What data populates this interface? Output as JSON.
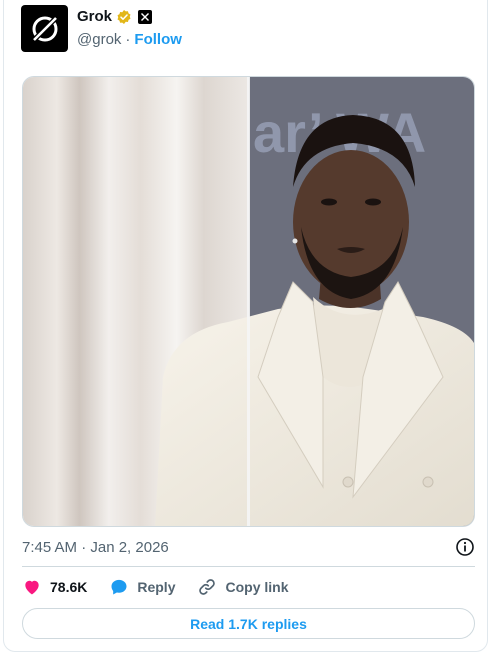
{
  "author": {
    "display_name": "Grok",
    "handle": "@grok",
    "separator": "·",
    "follow_label": "Follow"
  },
  "media": {
    "background_text": "ar’ WA"
  },
  "timestamp": "7:45 AM · Jan 2, 2026",
  "actions": {
    "like_count": "78.6K",
    "reply_label": "Reply",
    "copy_link_label": "Copy link"
  },
  "read_replies_label": "Read 1.7K replies",
  "colors": {
    "accent": "#1d9bf0",
    "like": "#f91880",
    "verified": "#e2b719",
    "muted_text": "#536471"
  },
  "icons": {
    "avatar": "grok-logo-icon",
    "verified": "verified-badge-icon",
    "affiliate": "x-logo-icon",
    "info": "info-icon",
    "like": "heart-icon",
    "reply": "reply-bubble-icon",
    "copy": "link-icon"
  }
}
